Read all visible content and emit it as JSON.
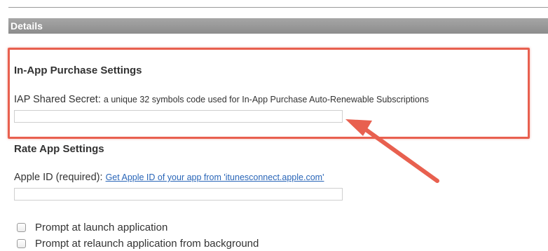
{
  "details": {
    "header": "Details"
  },
  "iap": {
    "heading": "In-App Purchase Settings",
    "secret_label": "IAP Shared Secret:",
    "secret_hint": "a unique 32 symbols code used for In-App Purchase Auto-Renewable Subscriptions",
    "secret_value": ""
  },
  "rate": {
    "heading": "Rate App Settings",
    "apple_id_label": "Apple ID (required):",
    "apple_id_link": "Get Apple ID of your app from 'itunesconnect.apple.com'",
    "apple_id_value": ""
  },
  "options": [
    {
      "label": "Prompt at launch application",
      "checked": false
    },
    {
      "label": "Prompt at relaunch application from background",
      "checked": false
    }
  ],
  "annotation": {
    "color": "#e8604f",
    "icon": "arrow-annotation-icon"
  }
}
